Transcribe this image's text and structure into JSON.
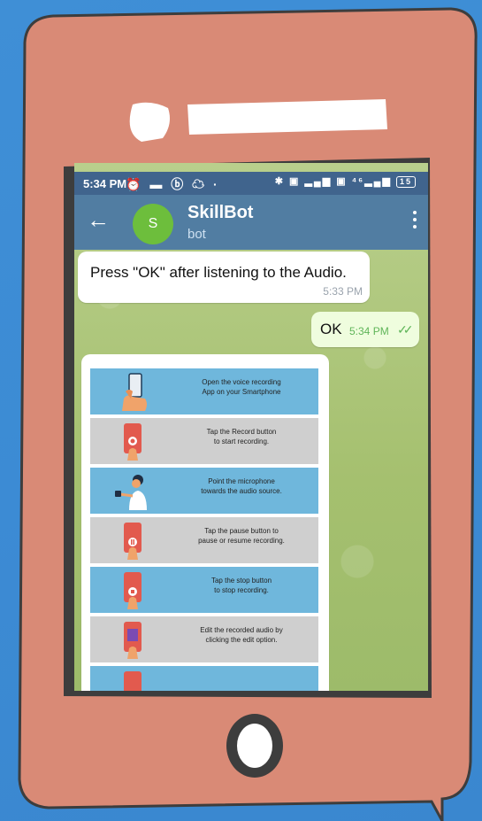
{
  "status_bar": {
    "time": "5:34 PM",
    "left_icons": "⏰ ▬ ⓑ ☁ ·",
    "right_icons": "✱ ▣ ▂▄▆ ▣ ⁴⁶▂▄▆",
    "battery": "15"
  },
  "chat_header": {
    "avatar_letter": "S",
    "name": "SkillBot",
    "subtitle": "bot",
    "avatar_color": "#6dbe3c"
  },
  "messages": [
    {
      "text": "Press \"OK\" after listening to the Audio.",
      "time": "5:33 PM",
      "direction": "incoming"
    },
    {
      "text": "OK",
      "time": "5:34 PM",
      "direction": "outgoing",
      "status": "read"
    }
  ],
  "instruction_steps": [
    {
      "line1": "Open the voice recording",
      "line2": "App on your Smartphone",
      "bg": "blue",
      "icon": "hand-holding-phone-icon"
    },
    {
      "line1": "Tap the Record button",
      "line2": "to start recording.",
      "bg": "gray",
      "icon": "phone-record-icon"
    },
    {
      "line1": "Point the microphone",
      "line2": "towards the audio source.",
      "bg": "blue",
      "icon": "person-with-phone-icon"
    },
    {
      "line1": "Tap the pause button to",
      "line2": "pause or resume recording.",
      "bg": "gray",
      "icon": "phone-pause-icon"
    },
    {
      "line1": "Tap the stop button",
      "line2": "to stop recording.",
      "bg": "blue",
      "icon": "phone-stop-icon"
    },
    {
      "line1": "Edit the recorded audio by",
      "line2": "clicking the edit option.",
      "bg": "gray",
      "icon": "phone-edit-icon"
    },
    {
      "line1": "",
      "line2": "",
      "bg": "blue",
      "icon": "phone-icon"
    }
  ],
  "colors": {
    "background": "#3c8bd4",
    "phone_body": "#d98a76",
    "phone_outline": "#3d3d3d",
    "app_bar": "#517da2",
    "status_bar": "#40648d",
    "chat_background": "#a9c27a"
  }
}
